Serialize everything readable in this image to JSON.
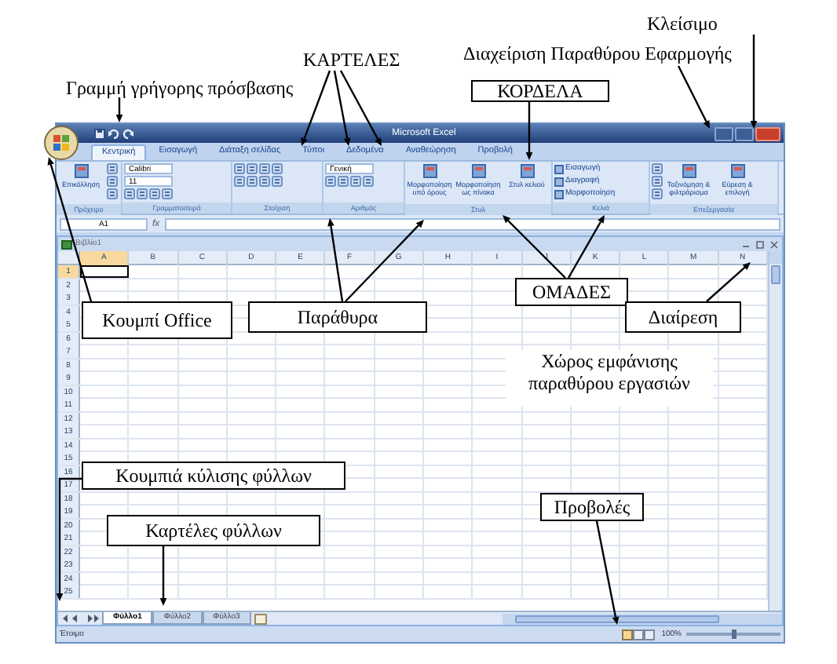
{
  "annotations": [
    {
      "text": "Κλείσιμο",
      "boxed": false
    },
    {
      "text": "ΚΑΡΤΕΛΕΣ",
      "boxed": false
    },
    {
      "text": "Διαχείριση Παραθύρου Εφαρμογής",
      "boxed": false
    },
    {
      "text": "Γραμμή γρήγορης πρόσβασης",
      "boxed": false
    },
    {
      "text": "ΚΟΡΔΕΛΑ",
      "boxed": true
    },
    {
      "text": "ΟΜΑΔΕΣ",
      "boxed": true
    },
    {
      "text": "Κουμπί Office",
      "boxed": true
    },
    {
      "text": "Παράθυρα",
      "boxed": true
    },
    {
      "text": "Διαίρεση",
      "boxed": true
    },
    {
      "text": "Χώρος εμφάνισης παραθύρου εργασιών",
      "boxed": false
    },
    {
      "text": "Κουμπιά κύλισης φύλλων",
      "boxed": true
    },
    {
      "text": "Προβολές",
      "boxed": true
    },
    {
      "text": "Καρτέλες φύλλων",
      "boxed": true
    }
  ],
  "window": {
    "title": "Microsoft Excel"
  },
  "tabs": [
    {
      "label": "Κεντρική",
      "selected": true
    },
    {
      "label": "Εισαγωγή",
      "selected": false
    },
    {
      "label": "Διάταξη σελίδας",
      "selected": false
    },
    {
      "label": "Τύποι",
      "selected": false
    },
    {
      "label": "Δεδομένα",
      "selected": false
    },
    {
      "label": "Αναθεώρηση",
      "selected": false
    },
    {
      "label": "Προβολή",
      "selected": false
    }
  ],
  "ribbon": {
    "groups": [
      {
        "label": "Πρόχειρο",
        "items": [
          {
            "kind": "large",
            "label": "Επικόλληση"
          },
          {
            "kind": "icon"
          },
          {
            "kind": "icon"
          },
          {
            "kind": "icon"
          }
        ]
      },
      {
        "label": "Γραμματοσειρά",
        "items": [
          {
            "kind": "field",
            "label": "Calibri"
          },
          {
            "kind": "field",
            "label": "11"
          },
          {
            "kind": "icons"
          }
        ]
      },
      {
        "label": "Στοίχιση",
        "items": [
          {
            "kind": "icons"
          },
          {
            "kind": "icons"
          }
        ]
      },
      {
        "label": "Αριθμός",
        "items": [
          {
            "kind": "field",
            "label": "Γενική"
          },
          {
            "kind": "icons"
          }
        ]
      },
      {
        "label": "Στυλ",
        "items": [
          {
            "kind": "large",
            "label": "Μορφοποίηση υπό όρους"
          },
          {
            "kind": "large",
            "label": "Μορφοποίηση ως πίνακα"
          },
          {
            "kind": "large",
            "label": "Στυλ κελιού"
          }
        ]
      },
      {
        "label": "Κελιά",
        "items": [
          {
            "kind": "small",
            "label": "Εισαγωγή"
          },
          {
            "kind": "small",
            "label": "Διαγραφή"
          },
          {
            "kind": "small",
            "label": "Μορφοποίηση"
          }
        ]
      },
      {
        "label": "Επεξεργασία",
        "items": [
          {
            "kind": "icon"
          },
          {
            "kind": "icon"
          },
          {
            "kind": "icon"
          },
          {
            "kind": "large",
            "label": "Ταξινόμηση & φιλτράρισμα"
          },
          {
            "kind": "large",
            "label": "Εύρεση & επιλογή"
          }
        ]
      }
    ]
  },
  "formula_bar": {
    "name_box": "A1",
    "function_label": "fx"
  },
  "workbook": {
    "title": "Βιβλίο1",
    "columns": [
      {
        "label": "A",
        "selected": true
      },
      {
        "label": "B",
        "selected": false
      },
      {
        "label": "C",
        "selected": false
      },
      {
        "label": "D",
        "selected": false
      },
      {
        "label": "E",
        "selected": false
      },
      {
        "label": "F",
        "selected": false
      },
      {
        "label": "G",
        "selected": false
      },
      {
        "label": "H",
        "selected": false
      },
      {
        "label": "I",
        "selected": false
      },
      {
        "label": "J",
        "selected": false
      },
      {
        "label": "K",
        "selected": false
      },
      {
        "label": "L",
        "selected": false
      },
      {
        "label": "M",
        "selected": false
      },
      {
        "label": "N",
        "selected": false
      }
    ],
    "rows": [
      {
        "label": "1",
        "selected": true
      },
      {
        "label": "2",
        "selected": false
      },
      {
        "label": "3",
        "selected": false
      },
      {
        "label": "4",
        "selected": false
      },
      {
        "label": "5",
        "selected": false
      },
      {
        "label": "6",
        "selected": false
      },
      {
        "label": "7",
        "selected": false
      },
      {
        "label": "8",
        "selected": false
      },
      {
        "label": "9",
        "selected": false
      },
      {
        "label": "10",
        "selected": false
      },
      {
        "label": "11",
        "selected": false
      },
      {
        "label": "12",
        "selected": false
      },
      {
        "label": "13",
        "selected": false
      },
      {
        "label": "14",
        "selected": false
      },
      {
        "label": "15",
        "selected": false
      },
      {
        "label": "16",
        "selected": false
      },
      {
        "label": "17",
        "selected": false
      },
      {
        "label": "18",
        "selected": false
      },
      {
        "label": "19",
        "selected": false
      },
      {
        "label": "20",
        "selected": false
      },
      {
        "label": "21",
        "selected": false
      },
      {
        "label": "22",
        "selected": false
      },
      {
        "label": "23",
        "selected": false
      },
      {
        "label": "24",
        "selected": false
      },
      {
        "label": "25",
        "selected": false
      }
    ]
  },
  "sheet_tabs": [
    {
      "label": "Φύλλο1",
      "selected": true
    },
    {
      "label": "Φύλλο2",
      "selected": false
    },
    {
      "label": "Φύλλο3",
      "selected": false
    }
  ],
  "status_bar": {
    "text": "Έτοιμο",
    "zoom": "100%",
    "zoom_slider": {
      "level": 0.5
    }
  }
}
